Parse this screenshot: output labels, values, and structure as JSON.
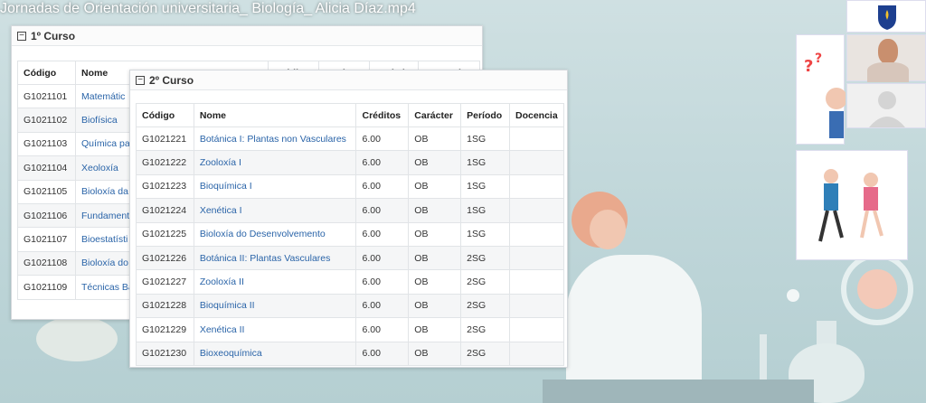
{
  "video": {
    "title": "Jornadas de Orientación universitaria_ Biología_ Alicia Díaz.mp4"
  },
  "curso1": {
    "title": "1º Curso",
    "headers": [
      "Código",
      "Nome",
      "Crédit",
      "Carácte",
      "Período",
      "Docenci"
    ],
    "rows": [
      {
        "code": "G1021101",
        "name": "Matemátic"
      },
      {
        "code": "G1021102",
        "name": "Biofísica"
      },
      {
        "code": "G1021103",
        "name": "Química pa"
      },
      {
        "code": "G1021104",
        "name": "Xeoloxía"
      },
      {
        "code": "G1021105",
        "name": "Bioloxía da"
      },
      {
        "code": "G1021106",
        "name": "Fundament"
      },
      {
        "code": "G1021107",
        "name": "Bioestatísti"
      },
      {
        "code": "G1021108",
        "name": "Bioloxía do"
      },
      {
        "code": "G1021109",
        "name": "Técnicas Bá"
      }
    ]
  },
  "curso2": {
    "title": "2º Curso",
    "headers": [
      "Código",
      "Nome",
      "Créditos",
      "Carácter",
      "Período",
      "Docencia"
    ],
    "rows": [
      {
        "code": "G1021221",
        "name": "Botánica I: Plantas non Vasculares",
        "credits": "6.00",
        "type": "OB",
        "period": "1SG",
        "docencia": ""
      },
      {
        "code": "G1021222",
        "name": "Zooloxía I",
        "credits": "6.00",
        "type": "OB",
        "period": "1SG",
        "docencia": ""
      },
      {
        "code": "G1021223",
        "name": "Bioquímica I",
        "credits": "6.00",
        "type": "OB",
        "period": "1SG",
        "docencia": ""
      },
      {
        "code": "G1021224",
        "name": "Xenética I",
        "credits": "6.00",
        "type": "OB",
        "period": "1SG",
        "docencia": ""
      },
      {
        "code": "G1021225",
        "name": "Bioloxía do Desenvolvemento",
        "credits": "6.00",
        "type": "OB",
        "period": "1SG",
        "docencia": ""
      },
      {
        "code": "G1021226",
        "name": "Botánica II: Plantas Vasculares",
        "credits": "6.00",
        "type": "OB",
        "period": "2SG",
        "docencia": ""
      },
      {
        "code": "G1021227",
        "name": "Zooloxía II",
        "credits": "6.00",
        "type": "OB",
        "period": "2SG",
        "docencia": ""
      },
      {
        "code": "G1021228",
        "name": "Bioquímica II",
        "credits": "6.00",
        "type": "OB",
        "period": "2SG",
        "docencia": ""
      },
      {
        "code": "G1021229",
        "name": "Xenética II",
        "credits": "6.00",
        "type": "OB",
        "period": "2SG",
        "docencia": ""
      },
      {
        "code": "G1021230",
        "name": "Bioxeoquímica",
        "credits": "6.00",
        "type": "OB",
        "period": "2SG",
        "docencia": ""
      }
    ]
  },
  "colors": {
    "link": "#2a64a8",
    "background": "#c9dcdf"
  },
  "icons": [
    "collapse-icon",
    "university-logo-icon",
    "user-avatar-icon",
    "question-marks-icon",
    "jumping-people-icon",
    "scientist-illustration"
  ]
}
